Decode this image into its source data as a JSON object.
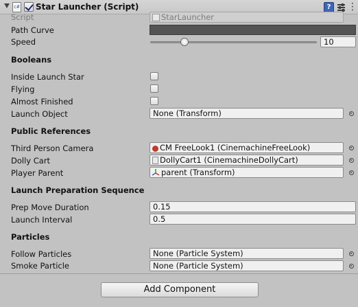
{
  "component": {
    "title": "Star Launcher (Script)",
    "icons": [
      "script-icon",
      "enabled-checkbox",
      "help-icon",
      "preset-icon",
      "gear-icon"
    ]
  },
  "fields": {
    "script": {
      "label": "Script",
      "value": "StarLauncher"
    },
    "path_curve": {
      "label": "Path Curve"
    },
    "speed": {
      "label": "Speed",
      "value": "10",
      "slider_fraction": 0.2
    }
  },
  "sections": {
    "booleans": {
      "title": "Booleans",
      "inside_launch_star": {
        "label": "Inside Launch Star",
        "checked": false
      },
      "flying": {
        "label": "Flying",
        "checked": false
      },
      "almost_finished": {
        "label": "Almost Finished",
        "checked": false
      },
      "launch_object": {
        "label": "Launch Object",
        "value": "None (Transform)"
      }
    },
    "public_references": {
      "title": "Public References",
      "third_person_camera": {
        "label": "Third Person Camera",
        "value": "CM FreeLook1 (CinemachineFreeLook)"
      },
      "dolly_cart": {
        "label": "Dolly Cart",
        "value": "DollyCart1 (CinemachineDollyCart)"
      },
      "player_parent": {
        "label": "Player Parent",
        "value": "parent (Transform)"
      }
    },
    "launch_preparation": {
      "title": "Launch Preparation Sequence",
      "prep_move_duration": {
        "label": "Prep Move Duration",
        "value": "0.15"
      },
      "launch_interval": {
        "label": "Launch Interval",
        "value": "0.5"
      }
    },
    "particles": {
      "title": "Particles",
      "follow_particles": {
        "label": "Follow Particles",
        "value": "None (Particle System)"
      },
      "smoke_particle": {
        "label": "Smoke Particle",
        "value": "None (Particle System)"
      }
    }
  },
  "add_component": {
    "label": "Add Component"
  },
  "colors": {
    "background": "#c2c2c2",
    "curve_field": "#545454",
    "help_icon": "#3c67b8"
  }
}
